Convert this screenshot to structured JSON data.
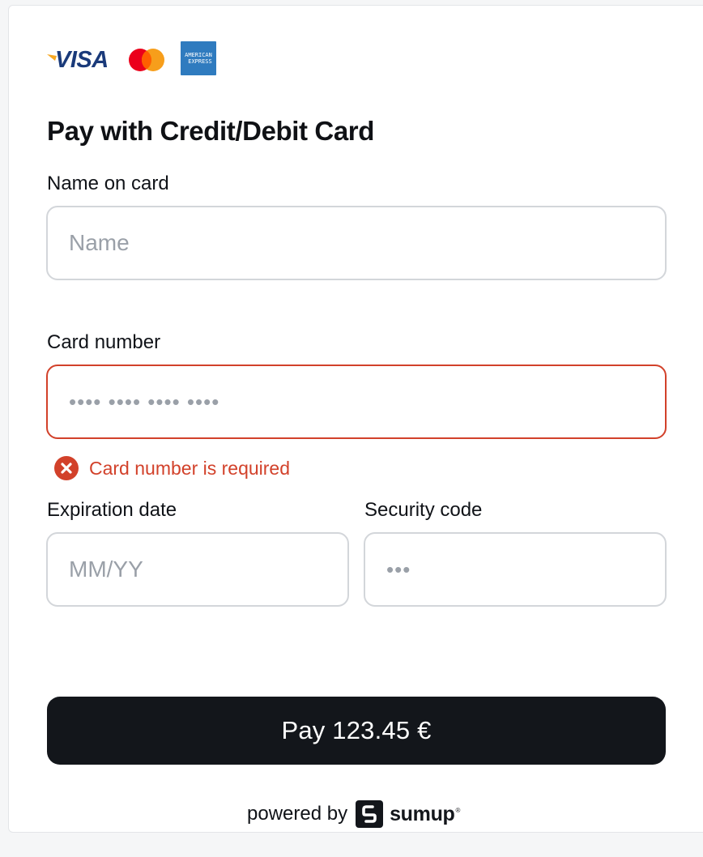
{
  "payment_logos": {
    "visa_text": "VISA",
    "amex_text_line1": "AMERICAN",
    "amex_text_line2": "EXPRESS",
    "visa_color": "#1a3a7a",
    "mastercard_red": "#eb001b",
    "mastercard_orange": "#f79e1b",
    "amex_blue": "#2f7bbf"
  },
  "form": {
    "title": "Pay with Credit/Debit Card",
    "name": {
      "label": "Name on card",
      "placeholder": "Name",
      "value": ""
    },
    "card_number": {
      "label": "Card number",
      "placeholder": "•••• •••• •••• ••••",
      "value": "",
      "error": "Card number is required"
    },
    "expiration": {
      "label": "Expiration date",
      "placeholder": "MM/YY",
      "value": ""
    },
    "security": {
      "label": "Security code",
      "placeholder": "•••",
      "value": ""
    }
  },
  "pay_button": {
    "label": "Pay 123.45 €"
  },
  "footer": {
    "powered_text": "powered by",
    "brand": "sumup",
    "brand_reg": "®"
  },
  "colors": {
    "error": "#d2412a",
    "button_bg": "#13161b",
    "border": "#d3d6da",
    "placeholder": "#9aa0a8"
  }
}
